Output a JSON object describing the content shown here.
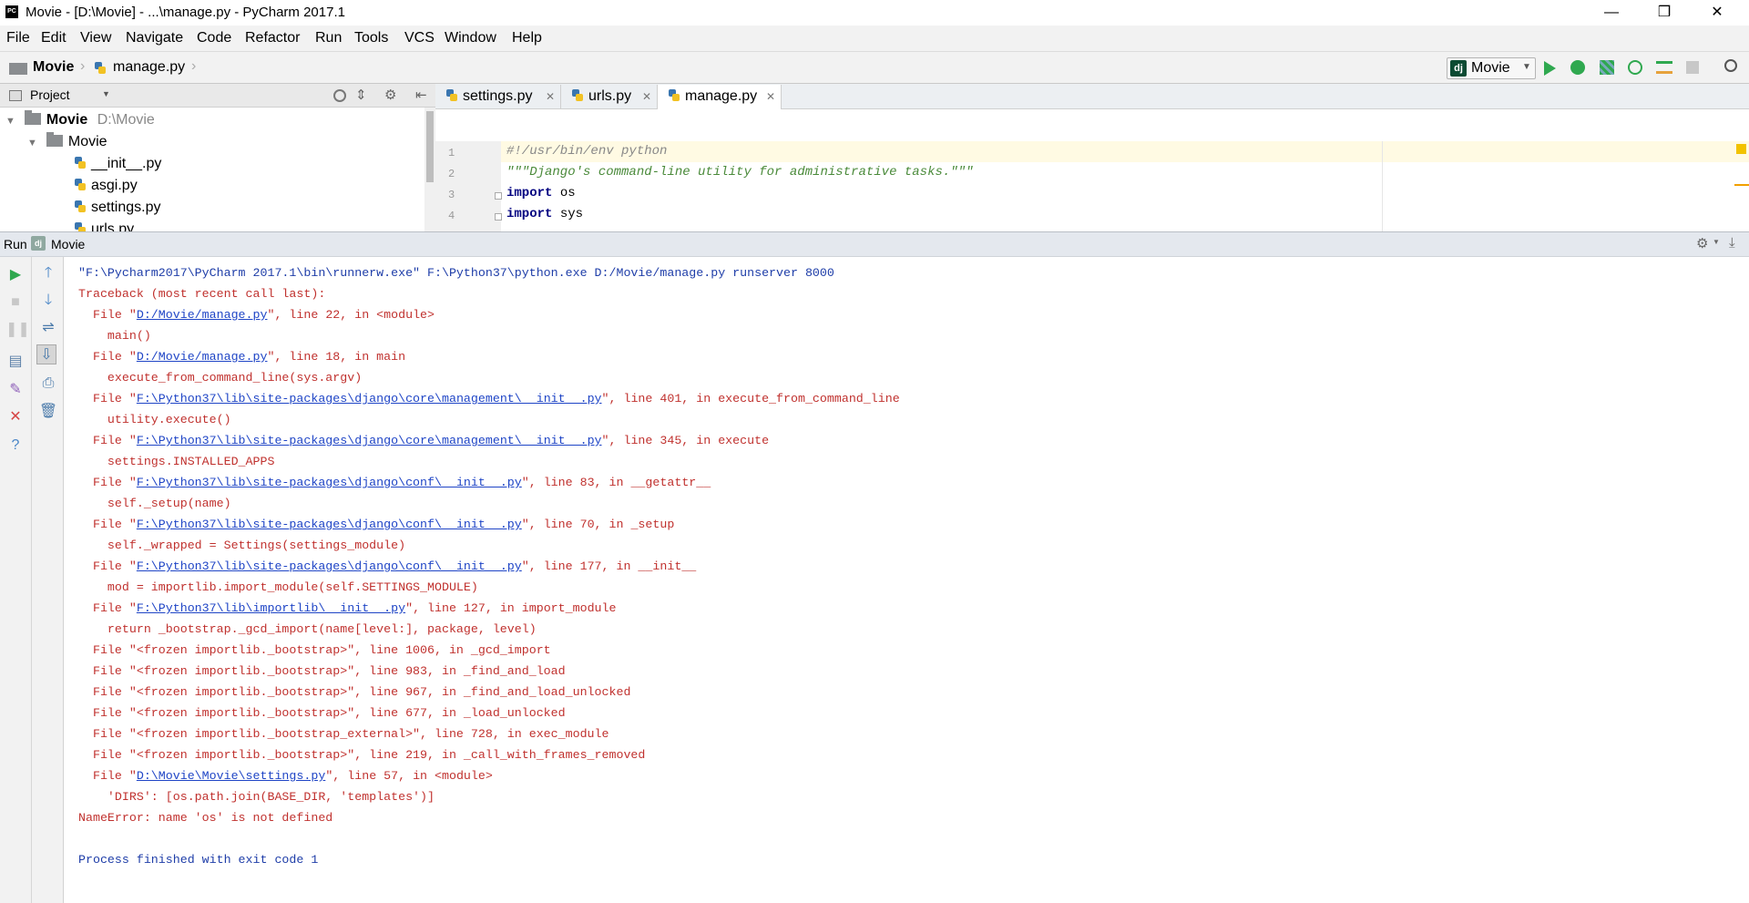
{
  "window": {
    "title": "Movie - [D:\\Movie] - ...\\manage.py - PyCharm 2017.1",
    "app_icon": "PC",
    "minimize": "—",
    "restore": "❒",
    "close": "✕"
  },
  "menu": [
    "File",
    "Edit",
    "View",
    "Navigate",
    "Code",
    "Refactor",
    "Run",
    "Tools",
    "VCS",
    "Window",
    "Help"
  ],
  "navbar": {
    "crumb_project": "Movie",
    "crumb_file": "manage.py",
    "run_config": "Movie",
    "run_config_icon": "dj"
  },
  "project_panel": {
    "title": "Project",
    "tree": [
      {
        "label": "Movie",
        "extra": "D:\\Movie",
        "type": "root"
      },
      {
        "label": "Movie",
        "type": "folder"
      },
      {
        "label": "__init__.py",
        "type": "file"
      },
      {
        "label": "asgi.py",
        "type": "file"
      },
      {
        "label": "settings.py",
        "type": "file"
      },
      {
        "label": "urls.py",
        "type": "file"
      }
    ]
  },
  "tabs": [
    "settings.py",
    "urls.py",
    "manage.py"
  ],
  "active_tab": 2,
  "editor": {
    "lines": [
      {
        "n": "1",
        "text": "#!/usr/bin/env python"
      },
      {
        "n": "2",
        "text": "\"\"\"Django's command-line utility for administrative tasks.\"\"\""
      },
      {
        "n": "3",
        "kw": "import",
        "rest": " os"
      },
      {
        "n": "4",
        "kw": "import",
        "rest": " sys"
      }
    ]
  },
  "run_panel": {
    "label": "Run",
    "config_icon": "dj",
    "config": "Movie"
  },
  "console": [
    {
      "cls": "cmd",
      "parts": [
        {
          "t": "\"F:\\Pycharm2017\\PyCharm 2017.1\\bin\\runnerw.exe\" F:\\Python37\\python.exe D:/Movie/manage.py runserver 8000"
        }
      ]
    },
    {
      "cls": "err",
      "parts": [
        {
          "t": "Traceback (most recent call last):"
        }
      ]
    },
    {
      "cls": "err",
      "parts": [
        {
          "t": "  File \""
        },
        {
          "t": "D:/Movie/manage.py",
          "link": true
        },
        {
          "t": "\", line 22, in <module>"
        }
      ]
    },
    {
      "cls": "err",
      "parts": [
        {
          "t": "    main()"
        }
      ]
    },
    {
      "cls": "err",
      "parts": [
        {
          "t": "  File \""
        },
        {
          "t": "D:/Movie/manage.py",
          "link": true
        },
        {
          "t": "\", line 18, in main"
        }
      ]
    },
    {
      "cls": "err",
      "parts": [
        {
          "t": "    execute_from_command_line(sys.argv)"
        }
      ]
    },
    {
      "cls": "err",
      "parts": [
        {
          "t": "  File \""
        },
        {
          "t": "F:\\Python37\\lib\\site-packages\\django\\core\\management\\__init__.py",
          "link": true
        },
        {
          "t": "\", line 401, in execute_from_command_line"
        }
      ]
    },
    {
      "cls": "err",
      "parts": [
        {
          "t": "    utility.execute()"
        }
      ]
    },
    {
      "cls": "err",
      "parts": [
        {
          "t": "  File \""
        },
        {
          "t": "F:\\Python37\\lib\\site-packages\\django\\core\\management\\__init__.py",
          "link": true
        },
        {
          "t": "\", line 345, in execute"
        }
      ]
    },
    {
      "cls": "err",
      "parts": [
        {
          "t": "    settings.INSTALLED_APPS"
        }
      ]
    },
    {
      "cls": "err",
      "parts": [
        {
          "t": "  File \""
        },
        {
          "t": "F:\\Python37\\lib\\site-packages\\django\\conf\\__init__.py",
          "link": true
        },
        {
          "t": "\", line 83, in __getattr__"
        }
      ]
    },
    {
      "cls": "err",
      "parts": [
        {
          "t": "    self._setup(name)"
        }
      ]
    },
    {
      "cls": "err",
      "parts": [
        {
          "t": "  File \""
        },
        {
          "t": "F:\\Python37\\lib\\site-packages\\django\\conf\\__init__.py",
          "link": true
        },
        {
          "t": "\", line 70, in _setup"
        }
      ]
    },
    {
      "cls": "err",
      "parts": [
        {
          "t": "    self._wrapped = Settings(settings_module)"
        }
      ]
    },
    {
      "cls": "err",
      "parts": [
        {
          "t": "  File \""
        },
        {
          "t": "F:\\Python37\\lib\\site-packages\\django\\conf\\__init__.py",
          "link": true
        },
        {
          "t": "\", line 177, in __init__"
        }
      ]
    },
    {
      "cls": "err",
      "parts": [
        {
          "t": "    mod = importlib.import_module(self.SETTINGS_MODULE)"
        }
      ]
    },
    {
      "cls": "err",
      "parts": [
        {
          "t": "  File \""
        },
        {
          "t": "F:\\Python37\\lib\\importlib\\__init__.py",
          "link": true
        },
        {
          "t": "\", line 127, in import_module"
        }
      ]
    },
    {
      "cls": "err",
      "parts": [
        {
          "t": "    return _bootstrap._gcd_import(name[level:], package, level)"
        }
      ]
    },
    {
      "cls": "err",
      "parts": [
        {
          "t": "  File \"<frozen importlib._bootstrap>\", line 1006, in _gcd_import"
        }
      ]
    },
    {
      "cls": "err",
      "parts": [
        {
          "t": "  File \"<frozen importlib._bootstrap>\", line 983, in _find_and_load"
        }
      ]
    },
    {
      "cls": "err",
      "parts": [
        {
          "t": "  File \"<frozen importlib._bootstrap>\", line 967, in _find_and_load_unlocked"
        }
      ]
    },
    {
      "cls": "err",
      "parts": [
        {
          "t": "  File \"<frozen importlib._bootstrap>\", line 677, in _load_unlocked"
        }
      ]
    },
    {
      "cls": "err",
      "parts": [
        {
          "t": "  File \"<frozen importlib._bootstrap_external>\", line 728, in exec_module"
        }
      ]
    },
    {
      "cls": "err",
      "parts": [
        {
          "t": "  File \"<frozen importlib._bootstrap>\", line 219, in _call_with_frames_removed"
        }
      ]
    },
    {
      "cls": "err",
      "parts": [
        {
          "t": "  File \""
        },
        {
          "t": "D:\\Movie\\Movie\\settings.py",
          "link": true
        },
        {
          "t": "\", line 57, in <module>"
        }
      ]
    },
    {
      "cls": "err",
      "parts": [
        {
          "t": "    'DIRS': [os.path.join(BASE_DIR, 'templates')]"
        }
      ]
    },
    {
      "cls": "err",
      "parts": [
        {
          "t": "NameError: name 'os' is not defined"
        }
      ]
    },
    {
      "cls": "cmd",
      "parts": [
        {
          "t": ""
        }
      ]
    },
    {
      "cls": "cmd",
      "parts": [
        {
          "t": "Process finished with exit code 1"
        }
      ]
    }
  ],
  "colors": {
    "error_text": "#c0312e",
    "info_text": "#1e3da8",
    "link_text": "#1f45c6",
    "run_green": "#2fa84f"
  }
}
